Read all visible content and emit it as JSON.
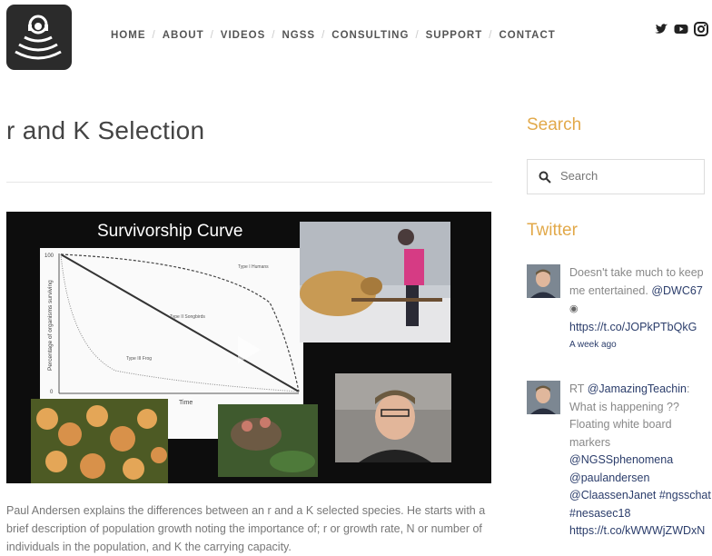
{
  "nav": {
    "items": [
      "HOME",
      "ABOUT",
      "VIDEOS",
      "NGSS",
      "CONSULTING",
      "SUPPORT",
      "CONTACT"
    ]
  },
  "social": [
    "twitter-icon",
    "youtube-icon",
    "instagram-icon"
  ],
  "page": {
    "title": "r and K Selection",
    "description": "Paul Andersen explains the differences between an r and a K selected species. He starts with a brief description of population growth noting the importance of; r or growth rate, N or number of individuals in the population, and K the carrying capacity."
  },
  "video": {
    "slide_title": "Survivorship Curve",
    "y_axis_label": "Percentage of organisms surviving",
    "x_axis_label": "Time",
    "tick_100": "100",
    "tick_0": "0",
    "type1_label": "Type I\nHumans",
    "type2_label": "Type II\nSongbirds",
    "type3_label": "Type III\nFrog"
  },
  "sidebar": {
    "search_heading": "Search",
    "search_placeholder": "Search",
    "twitter_heading": "Twitter",
    "tweets": [
      {
        "text": "Doesn't take much to keep me entertained.",
        "mention": "@DWC67",
        "link": "https://t.co/JOPkPTbQkG",
        "time": "A week ago"
      },
      {
        "prefix": "RT",
        "mention": "@JamazingTeachin",
        "text": "What is happening ?? Floating white board markers",
        "mentions": "@NGSSphenomena @paulandersen @ClaassenJanet #ngsschat #nesasec18",
        "link": "https://t.co/kWWWjZWDxN"
      }
    ]
  },
  "colors": {
    "accent": "#e2a94a",
    "link": "#2b3d6b"
  }
}
